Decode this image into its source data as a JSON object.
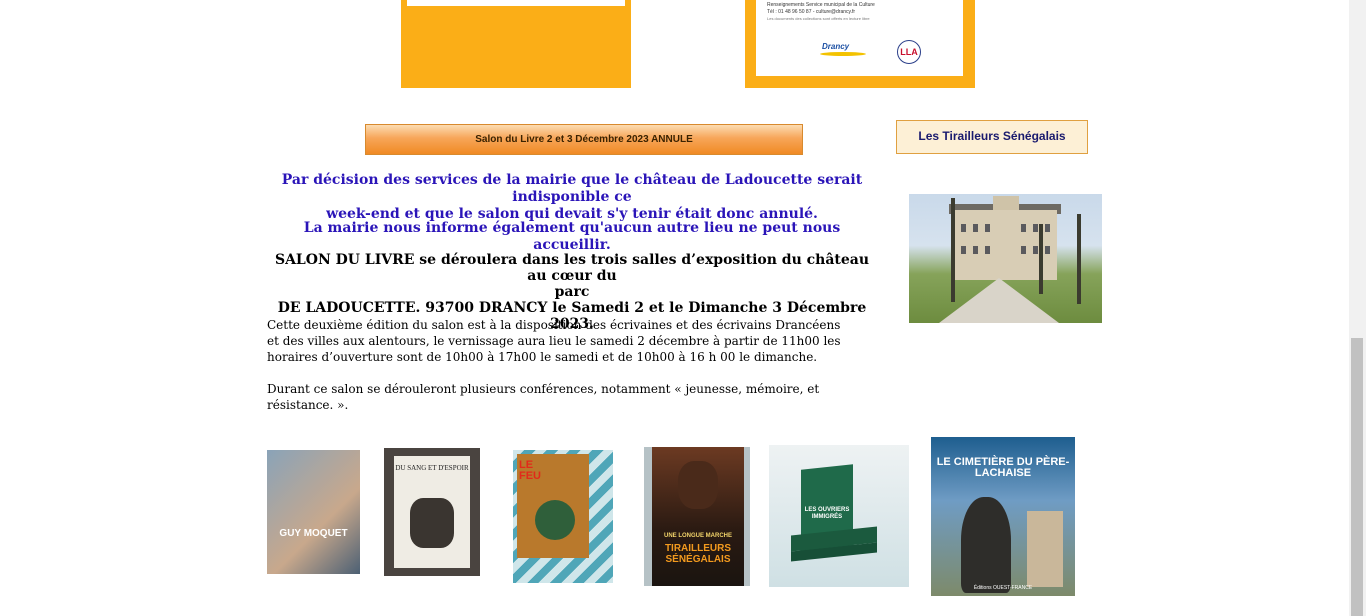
{
  "posters": {
    "left": {
      "type": "orange-poster"
    },
    "right": {
      "info_line1": "Renseignements Service municipal de la Culture",
      "info_line2": "Tél : 01 48 96 50 87 - culture@drancy.fr",
      "info_line3": "Les documents des collections sont offerts en lecture libre",
      "logo_drancy": "Drancy",
      "logo_circle": "LLA"
    }
  },
  "salon_button": {
    "label": "Salon du Livre 2 et 3 Décembre 2023 ANNULE"
  },
  "tirailleurs_button": {
    "label": "Les Tirailleurs Sénégalais"
  },
  "notice": {
    "line1": "Par décision des services de la mairie que le château de Ladoucette serait indisponible ce",
    "line2": "week-end et que le salon qui devait s'y tenir était donc annulé.",
    "line3": "La mairie nous informe également qu'aucun autre lieu ne peut nous accueillir."
  },
  "salon_info": {
    "line1": "SALON DU LIVRE se déroulera dans les trois salles d’exposition du château au cœur du",
    "line2": "parc",
    "line3": "DE LADOUCETTE. 93700 DRANCY le Samedi 2 et le Dimanche 3 Décembre 2023."
  },
  "description": {
    "line1": "Cette deuxième édition du salon est à la disposition des écrivaines et des écrivains Drancéens",
    "line2": "et des villes aux alentours, le vernissage aura lieu le samedi 2 décembre à partir de 11h00 les",
    "line3": "horaires d’ouverture sont de 10h00 à 17h00 le samedi et de 10h00 à 16 h 00 le dimanche.",
    "line4": "Durant ce salon se dérouleront plusieurs conférences, notamment « jeunesse, mémoire, et résistance. »."
  },
  "books": [
    {
      "title": "GUY MOQUET"
    },
    {
      "title": "DU SANG ET D'ESPOIR"
    },
    {
      "title": "LE FEU"
    },
    {
      "title": "TIRAILLEURS SÉNÉGALAIS",
      "subtitle": "UNE LONGUE MARCHE"
    },
    {
      "title": "LES OUVRIERS IMMIGRÉS"
    },
    {
      "title": "LE CIMETIÈRE DU PÈRE-LACHAISE",
      "publisher": "Éditions OUEST-FRANCE"
    }
  ],
  "colors": {
    "poster_orange": "#fbae17",
    "notice_blue": "#2a14b8",
    "button_orange": "#f08a24"
  }
}
